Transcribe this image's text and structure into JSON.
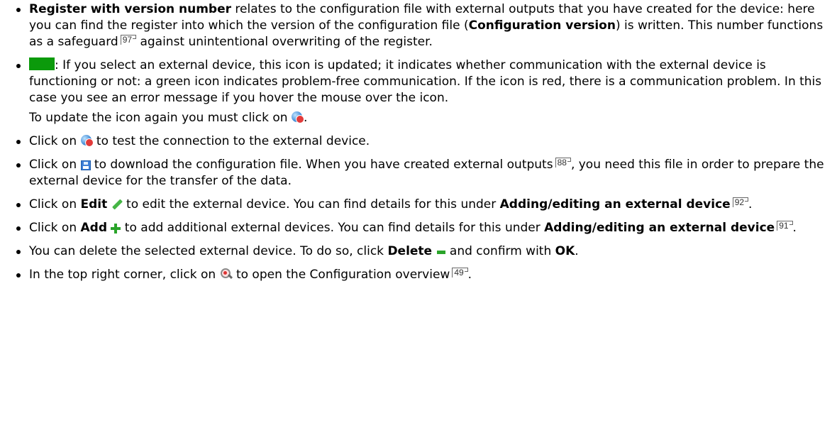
{
  "items": [
    {
      "bold": "Register with version number",
      "t1": " relates to the configuration file with external outputs that you have created for the device: here you can find the register into which the version of the configuration file (",
      "bold2": "Configuration version",
      "t2": ") is written. This number functions as a safeguard",
      "ref": "97",
      "t3": " against unintentional overwriting of the register."
    },
    {
      "t1": ": If you select an external device, this icon is updated; it indicates whether communication with the external device is functioning or not: a green icon indicates problem-free communication. If the icon is red, there is a communication problem. In this case you see an error message if you hover the mouse over the icon.",
      "t2": "To update the icon again you must click on ",
      "t3": "."
    },
    {
      "t1": "Click on ",
      "t2": " to test the connection to the external device."
    },
    {
      "t1": "Click on ",
      "t2": " to download the configuration file. When you have created external outputs",
      "ref": "88",
      "t3": ", you need this file in order to prepare the external device for the transfer of the data."
    },
    {
      "t1": "Click on ",
      "bold": "Edit",
      "t2": " to edit the external device. You can find details for this under ",
      "bold2": "Adding/editing an external device",
      "ref": "92",
      "t3": "."
    },
    {
      "t1": "Click on ",
      "bold": "Add",
      "t2": " to add additional external devices. You can find details for this under ",
      "bold2": "Adding/editing an external device",
      "ref": "91",
      "t3": "."
    },
    {
      "t1": "You can delete the selected external device. To do so, click ",
      "bold": "Delete",
      "t2": " and confirm with ",
      "bold2": "OK",
      "t3": "."
    },
    {
      "t1": "In the top right corner, click on ",
      "t2": " to open the Configuration overview",
      "ref": "49",
      "t3": "."
    }
  ],
  "icons": {
    "status": "green-status-icon",
    "test": "test-connection-icon",
    "download": "floppy-disk-icon",
    "edit": "pencil-icon",
    "add": "plus-icon",
    "delete": "minus-icon",
    "overview": "magnifier-icon"
  },
  "colors": {
    "status_green": "#0b9a0b",
    "icon_green": "#2aa42a"
  }
}
